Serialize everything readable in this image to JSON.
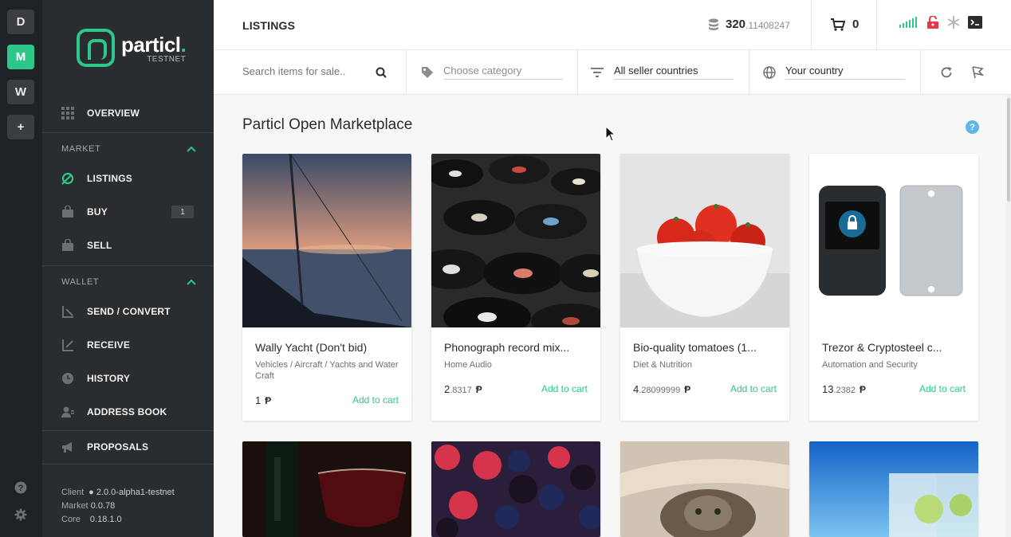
{
  "rail": {
    "wallets": [
      "D",
      "M",
      "W"
    ],
    "add_label": "+"
  },
  "sidebar": {
    "logo_name": "particl",
    "logo_sub": "TESTNET",
    "overview": "OVERVIEW",
    "market_header": "MARKET",
    "market_items": [
      {
        "label": "LISTINGS",
        "icon": "leaf-icon"
      },
      {
        "label": "BUY",
        "icon": "bag-icon",
        "badge": "1"
      },
      {
        "label": "SELL",
        "icon": "bag-icon"
      }
    ],
    "wallet_header": "WALLET",
    "wallet_items": [
      {
        "label": "SEND / CONVERT",
        "icon": "send-icon"
      },
      {
        "label": "RECEIVE",
        "icon": "receive-icon"
      },
      {
        "label": "HISTORY",
        "icon": "clock-icon"
      },
      {
        "label": "ADDRESS BOOK",
        "icon": "contacts-icon"
      }
    ],
    "proposals": "PROPOSALS",
    "versions": [
      {
        "label": "Client",
        "value": "2.0.0-alpha1-testnet"
      },
      {
        "label": "Market",
        "value": "0.0.78"
      },
      {
        "label": "Core",
        "value": "0.18.1.0"
      }
    ]
  },
  "header": {
    "title": "LISTINGS",
    "balance_int": "320",
    "balance_dec": ".11408247",
    "cart_count": "0"
  },
  "filters": {
    "search_placeholder": "Search items for sale..",
    "category_placeholder": "Choose category",
    "seller_countries": "All seller countries",
    "your_country": "Your country"
  },
  "main": {
    "title": "Particl Open Marketplace",
    "help": "?"
  },
  "listings": [
    {
      "title": "Wally Yacht (Don't bid)",
      "category": "Vehicles / Aircraft / Yachts and Water Craft",
      "price_int": "1",
      "price_dec": "",
      "currency": "Ᵽ",
      "action": "Add to cart"
    },
    {
      "title": "Phonograph record mix...",
      "category": "Home Audio",
      "price_int": "2",
      "price_dec": ".8317",
      "currency": "Ᵽ",
      "action": "Add to cart"
    },
    {
      "title": "Bio-quality tomatoes (1...",
      "category": "Diet & Nutrition",
      "price_int": "4",
      "price_dec": ".28099999",
      "currency": "Ᵽ",
      "action": "Add to cart"
    },
    {
      "title": "Trezor & Cryptosteel c...",
      "category": "Automation and Security",
      "price_int": "13",
      "price_dec": ".2382",
      "currency": "Ᵽ",
      "action": "Add to cart"
    }
  ],
  "colors": {
    "accent": "#2dc889",
    "sidebar_bg": "#2a2d30",
    "rail_bg": "#1f2224"
  }
}
